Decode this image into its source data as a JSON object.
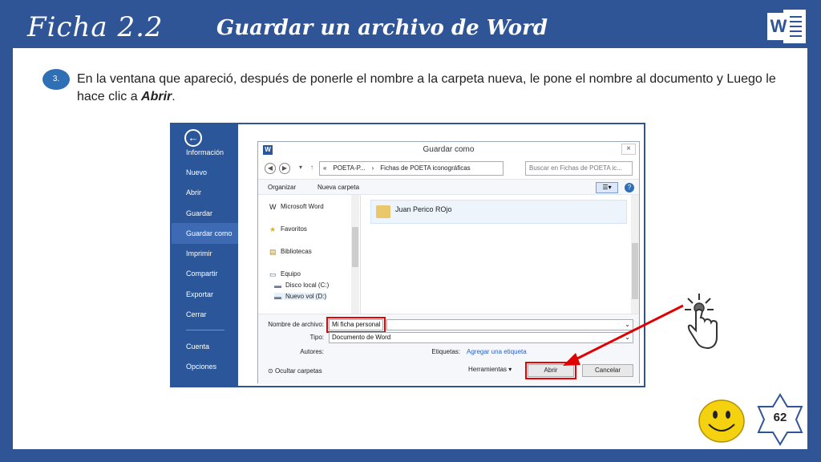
{
  "header": {
    "ficha": "Ficha 2.2",
    "title": "Guardar un archivo de Word",
    "word_letter": "W"
  },
  "step": {
    "number": "3.",
    "text_before": "En la ventana que apareció, después de ponerle el nombre a la carpeta nueva, le pone el nombre al documento y Luego le hace clic a ",
    "emphasis": "Abrir",
    "text_after": "."
  },
  "backstage": {
    "back_glyph": "←",
    "items": [
      {
        "label": "Información"
      },
      {
        "label": "Nuevo"
      },
      {
        "label": "Abrir"
      },
      {
        "label": "Guardar"
      },
      {
        "label": "Guardar como"
      },
      {
        "label": "Imprimir"
      },
      {
        "label": "Compartir"
      },
      {
        "label": "Exportar"
      },
      {
        "label": "Cerrar"
      },
      {
        "label": "Cuenta"
      },
      {
        "label": "Opciones"
      }
    ]
  },
  "dialog": {
    "title": "Guardar como",
    "word_letter": "W",
    "close": "×",
    "address": {
      "prefix": "«",
      "part1": "POETA-P...",
      "sep": "›",
      "part2": "Fichas de POETA iconográficas"
    },
    "search_placeholder": "Buscar en Fichas de POETA ic...",
    "toolbar": {
      "organize": "Organizar",
      "new_folder": "Nueva carpeta",
      "help": "?"
    },
    "tree": [
      {
        "label": "Microsoft Word",
        "icon": "W"
      },
      {
        "label": "Favoritos",
        "icon": "★"
      },
      {
        "label": "Bibliotecas",
        "icon": "▤"
      },
      {
        "label": "Equipo",
        "icon": "▭"
      },
      {
        "label": "Disco local (C:)",
        "icon": "▬"
      },
      {
        "label": "Nuevo vol (D:)",
        "icon": "▬"
      }
    ],
    "folder": "Juan Perico ROjo",
    "form": {
      "filename_label": "Nombre de archivo:",
      "filename_value": "Mi ficha personal",
      "type_label": "Tipo:",
      "type_value": "Documento de Word",
      "authors_label": "Autores:",
      "tags_label": "Etiquetas:",
      "tags_link": "Agregar una etiqueta",
      "hide_folders": "Ocultar carpetas",
      "tools": "Herramientas",
      "open_button": "Abrir",
      "cancel_button": "Cancelar"
    }
  },
  "page_number": "62",
  "colors": {
    "background": "#2f5597",
    "word_blue": "#2b579a",
    "highlight_red": "#e00000",
    "smiley_yellow": "#f5d20f"
  }
}
